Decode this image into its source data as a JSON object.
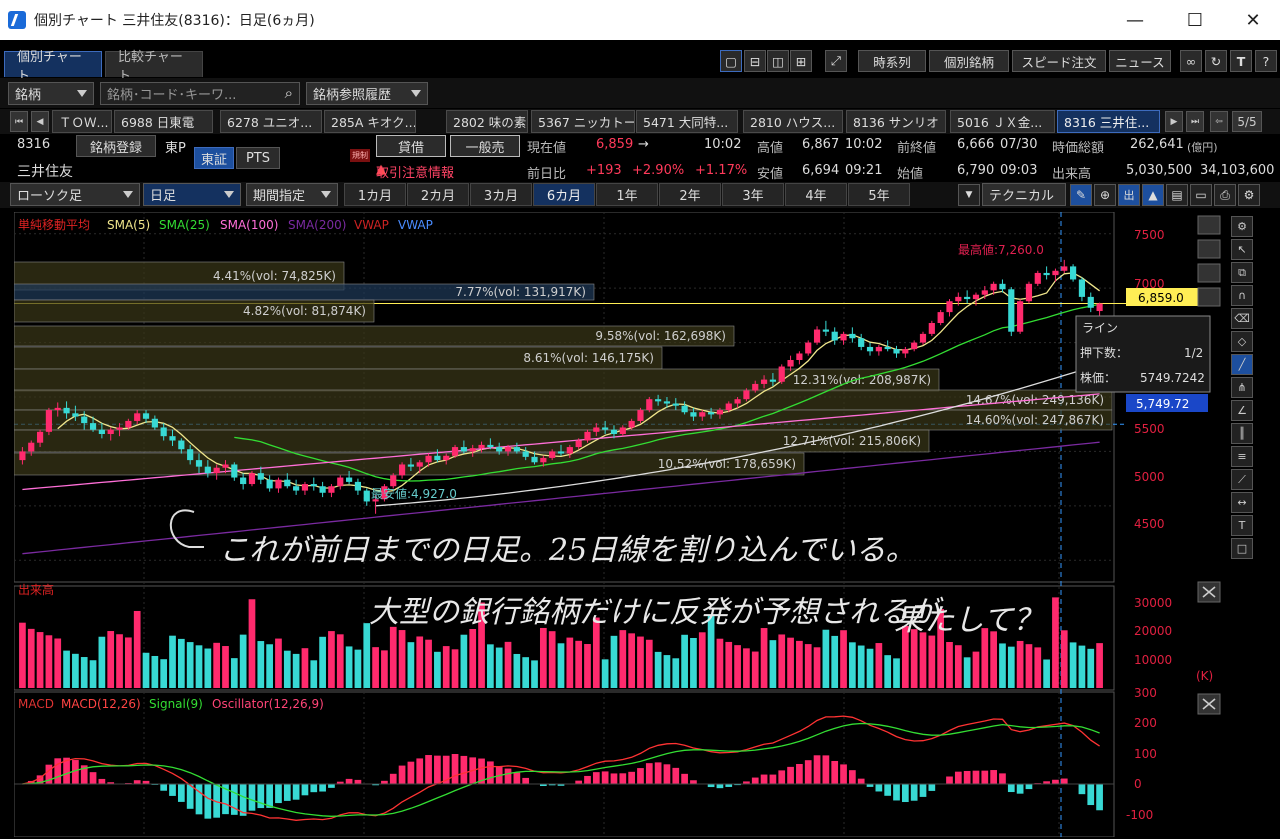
{
  "window": {
    "title": "個別チャート 三井住友(8316)：日足(6ヵ月)",
    "minimize": "—",
    "maximize": "☐",
    "close": "✕"
  },
  "tabs": [
    "個別チャート",
    "比較チャート"
  ],
  "toolbar": {
    "timeseries": "時系列",
    "individual": "個別銘柄",
    "speed_order": "スピード注文",
    "news": "ニュース"
  },
  "search": {
    "type": "銘柄",
    "placeholder": "銘柄･コード･キーワ...",
    "history": "銘柄参照履歴"
  },
  "stock_tabs": [
    "ＴＯＷ...",
    "6988 日東電",
    "6278 ユニオ...",
    "285A キオク...",
    "2802 味の素",
    "5367 ニッカトー",
    "5471 大同特...",
    "2810 ハウス...",
    "8136 サンリオ",
    "5016 ＪＸ金...",
    "8316 三井住..."
  ],
  "page_counter": "5/5",
  "quote": {
    "code": "8316",
    "name": "三井住友",
    "register": "銘柄登録",
    "market": "東P",
    "exch_tse": "東証",
    "exch_pts": "PTS",
    "credit_badge": "貸借",
    "margin_badge": "一般売",
    "tag": "規制",
    "alert": "取引注意情報",
    "cur_label": "現在値",
    "cur_val": "6,859",
    "cur_arrow": "→",
    "cur_time": "10:02",
    "chg_label": "前日比",
    "chg_val": "+193",
    "chg_pct": "+2.90%",
    "chg_pct2": "+1.17%",
    "high_label": "高値",
    "high_val": "6,867",
    "high_time": "10:02",
    "low_label": "安値",
    "low_val": "6,694",
    "low_time": "09:21",
    "prev_label": "前終値",
    "prev_val": "6,666",
    "prev_date": "07/30",
    "open_label": "始値",
    "open_val": "6,790",
    "open_time": "09:03",
    "mcap_label": "時価総額",
    "mcap_val": "262,641",
    "mcap_unit": "(億円)",
    "vol_label": "出来高",
    "vol_val": "5,030,500",
    "vol_val2": "34,103,600"
  },
  "controls": {
    "candle": "ローソク足",
    "interval": "日足",
    "period": "期間指定",
    "periods": [
      "1カ月",
      "2カ月",
      "3カ月",
      "6カ月",
      "1年",
      "2年",
      "3年",
      "4年",
      "5年"
    ],
    "selected_period": "6カ月",
    "technical": "テクニカル"
  },
  "legend": {
    "title": "単純移動平均",
    "items": [
      {
        "label": "SMA(5)",
        "color": "#f0e68c"
      },
      {
        "label": "SMA(25)",
        "color": "#33dd33"
      },
      {
        "label": "SMA(100)",
        "color": "#ff6fd8"
      },
      {
        "label": "SMA(200)",
        "color": "#7a2aa0"
      },
      {
        "label": "VWAP",
        "color": "#cc2222"
      },
      {
        "label": "VWAP",
        "color": "#4a8cff"
      }
    ]
  },
  "price_axis": [
    "7500",
    "7000",
    "6500",
    "6000",
    "5500",
    "5000",
    "4500"
  ],
  "price_tag": "6,859.0",
  "line_tag": "5,749.72",
  "max_label": "最高値:7,260.0",
  "min_label": "最安値:4,927.0",
  "vp_labels": [
    "4.41%(vol: 74,825K)",
    "7.77%(vol: 131,917K)",
    "4.82%(vol: 81,874K)",
    "9.58%(vol: 162,698K)",
    "8.61%(vol: 146,175K)",
    "12.31%(vol: 208,987K)",
    "14.67%(vol: 249,136K)",
    "14.60%(vol: 247,867K)",
    "12.71%(vol: 215,806K)",
    "10.52%(vol: 178,659K)"
  ],
  "tooltip": {
    "title": "ライン",
    "count_label": "押下数：",
    "count": "1/2",
    "price_label": "株価：",
    "price": "5749.7242"
  },
  "volume_panel": {
    "title": "出来高",
    "axis": [
      "30000",
      "20000",
      "10000"
    ],
    "unit": "(K)"
  },
  "macd_panel": {
    "labels": [
      {
        "label": "MACD",
        "color": "#dd3333"
      },
      {
        "label": "MACD(12,26)",
        "color": "#ff4444"
      },
      {
        "label": "Signal(9)",
        "color": "#33dd33"
      },
      {
        "label": "Oscillator(12,26,9)",
        "color": "#ff4477"
      }
    ],
    "axis": [
      "300",
      "200",
      "100",
      "0",
      "-100"
    ]
  },
  "handwriting": {
    "line1": "これが前日までの日足。25日線を割り込んでいる。",
    "line2": "大型の銀行銘柄だけに反発が予想されるが",
    "line3": "果たして？"
  },
  "chart_data": {
    "type": "candlestick",
    "title": "三井住友(8316) 日足(6ヵ月)",
    "ylim": [
      4300,
      7700
    ],
    "candles": [
      [
        5420,
        5540,
        5380,
        5500
      ],
      [
        5500,
        5600,
        5460,
        5580
      ],
      [
        5580,
        5700,
        5540,
        5680
      ],
      [
        5680,
        5900,
        5650,
        5880
      ],
      [
        5880,
        5950,
        5820,
        5900
      ],
      [
        5900,
        5960,
        5800,
        5850
      ],
      [
        5850,
        5920,
        5780,
        5820
      ],
      [
        5820,
        5870,
        5700,
        5760
      ],
      [
        5760,
        5820,
        5680,
        5700
      ],
      [
        5700,
        5760,
        5620,
        5660
      ],
      [
        5660,
        5720,
        5600,
        5700
      ],
      [
        5700,
        5760,
        5640,
        5720
      ],
      [
        5720,
        5800,
        5700,
        5780
      ],
      [
        5780,
        5880,
        5750,
        5850
      ],
      [
        5850,
        5880,
        5760,
        5800
      ],
      [
        5800,
        5830,
        5700,
        5720
      ],
      [
        5720,
        5760,
        5600,
        5640
      ],
      [
        5640,
        5700,
        5550,
        5600
      ],
      [
        5600,
        5620,
        5480,
        5520
      ],
      [
        5520,
        5560,
        5380,
        5420
      ],
      [
        5420,
        5480,
        5300,
        5360
      ],
      [
        5360,
        5420,
        5260,
        5300
      ],
      [
        5300,
        5380,
        5240,
        5350
      ],
      [
        5350,
        5420,
        5300,
        5380
      ],
      [
        5380,
        5400,
        5230,
        5260
      ],
      [
        5260,
        5300,
        5150,
        5200
      ],
      [
        5200,
        5320,
        5180,
        5300
      ],
      [
        5300,
        5360,
        5200,
        5240
      ],
      [
        5240,
        5280,
        5130,
        5160
      ],
      [
        5160,
        5260,
        5120,
        5240
      ],
      [
        5240,
        5300,
        5160,
        5180
      ],
      [
        5180,
        5240,
        5100,
        5140
      ],
      [
        5140,
        5220,
        5100,
        5200
      ],
      [
        5200,
        5260,
        5140,
        5180
      ],
      [
        5180,
        5220,
        5080,
        5120
      ],
      [
        5120,
        5200,
        5080,
        5180
      ],
      [
        5180,
        5280,
        5150,
        5260
      ],
      [
        5260,
        5320,
        5200,
        5220
      ],
      [
        5220,
        5250,
        5100,
        5140
      ],
      [
        5140,
        5160,
        5000,
        5040
      ],
      [
        5040,
        5100,
        4927,
        5060
      ],
      [
        5060,
        5200,
        5040,
        5180
      ],
      [
        5180,
        5300,
        5160,
        5280
      ],
      [
        5280,
        5400,
        5250,
        5380
      ],
      [
        5380,
        5440,
        5320,
        5360
      ],
      [
        5360,
        5420,
        5300,
        5400
      ],
      [
        5400,
        5480,
        5360,
        5460
      ],
      [
        5460,
        5520,
        5400,
        5420
      ],
      [
        5420,
        5480,
        5380,
        5460
      ],
      [
        5460,
        5560,
        5440,
        5540
      ],
      [
        5540,
        5600,
        5480,
        5500
      ],
      [
        5500,
        5560,
        5450,
        5530
      ],
      [
        5530,
        5590,
        5490,
        5560
      ],
      [
        5560,
        5620,
        5520,
        5540
      ],
      [
        5540,
        5580,
        5470,
        5500
      ],
      [
        5500,
        5560,
        5460,
        5540
      ],
      [
        5540,
        5580,
        5480,
        5500
      ],
      [
        5500,
        5540,
        5420,
        5450
      ],
      [
        5450,
        5500,
        5380,
        5400
      ],
      [
        5400,
        5460,
        5360,
        5440
      ],
      [
        5440,
        5520,
        5420,
        5500
      ],
      [
        5500,
        5560,
        5460,
        5480
      ],
      [
        5480,
        5560,
        5440,
        5540
      ],
      [
        5540,
        5620,
        5520,
        5600
      ],
      [
        5600,
        5700,
        5580,
        5680
      ],
      [
        5680,
        5760,
        5640,
        5720
      ],
      [
        5720,
        5780,
        5660,
        5700
      ],
      [
        5700,
        5740,
        5620,
        5660
      ],
      [
        5660,
        5740,
        5640,
        5720
      ],
      [
        5720,
        5800,
        5700,
        5780
      ],
      [
        5780,
        5900,
        5760,
        5880
      ],
      [
        5880,
        6000,
        5860,
        5980
      ],
      [
        5980,
        6020,
        5920,
        5960
      ],
      [
        5960,
        6000,
        5900,
        5940
      ],
      [
        5940,
        5990,
        5880,
        5920
      ],
      [
        5920,
        5960,
        5840,
        5860
      ],
      [
        5860,
        5900,
        5780,
        5820
      ],
      [
        5820,
        5880,
        5780,
        5860
      ],
      [
        5860,
        5900,
        5800,
        5840
      ],
      [
        5840,
        5900,
        5800,
        5880
      ],
      [
        5880,
        5960,
        5860,
        5940
      ],
      [
        5940,
        6000,
        5900,
        5980
      ],
      [
        5980,
        6080,
        5960,
        6060
      ],
      [
        6060,
        6150,
        6040,
        6120
      ],
      [
        6120,
        6200,
        6080,
        6160
      ],
      [
        6160,
        6220,
        6100,
        6140
      ],
      [
        6140,
        6300,
        6120,
        6280
      ],
      [
        6280,
        6380,
        6240,
        6340
      ],
      [
        6340,
        6420,
        6300,
        6400
      ],
      [
        6400,
        6520,
        6380,
        6500
      ],
      [
        6500,
        6650,
        6480,
        6620
      ],
      [
        6620,
        6700,
        6560,
        6600
      ],
      [
        6600,
        6640,
        6480,
        6520
      ],
      [
        6520,
        6600,
        6480,
        6580
      ],
      [
        6580,
        6640,
        6500,
        6540
      ],
      [
        6540,
        6580,
        6430,
        6460
      ],
      [
        6460,
        6500,
        6380,
        6420
      ],
      [
        6420,
        6480,
        6380,
        6460
      ],
      [
        6460,
        6520,
        6420,
        6440
      ],
      [
        6440,
        6470,
        6360,
        6400
      ],
      [
        6400,
        6460,
        6360,
        6440
      ],
      [
        6440,
        6520,
        6420,
        6500
      ],
      [
        6500,
        6600,
        6480,
        6580
      ],
      [
        6580,
        6700,
        6560,
        6680
      ],
      [
        6680,
        6800,
        6660,
        6780
      ],
      [
        6780,
        6900,
        6740,
        6880
      ],
      [
        6880,
        6960,
        6840,
        6920
      ],
      [
        6920,
        6980,
        6860,
        6900
      ],
      [
        6900,
        6960,
        6840,
        6940
      ],
      [
        6940,
        7020,
        6900,
        6980
      ],
      [
        6980,
        7060,
        6940,
        7040
      ],
      [
        7040,
        7080,
        6960,
        6990
      ],
      [
        6990,
        7010,
        6560,
        6600
      ],
      [
        6600,
        6900,
        6580,
        6880
      ],
      [
        6880,
        7060,
        6860,
        7040
      ],
      [
        7040,
        7160,
        7020,
        7140
      ],
      [
        7140,
        7200,
        7080,
        7120
      ],
      [
        7120,
        7180,
        7060,
        7160
      ],
      [
        7160,
        7260,
        7140,
        7200
      ],
      [
        7200,
        7220,
        7060,
        7080
      ],
      [
        7080,
        7100,
        6880,
        6920
      ],
      [
        6920,
        6960,
        6780,
        6820
      ],
      [
        6790,
        6867,
        6694,
        6859
      ]
    ]
  }
}
